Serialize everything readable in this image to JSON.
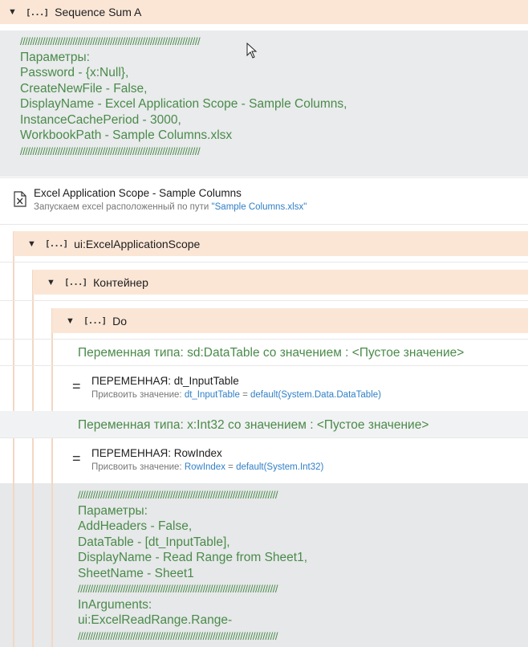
{
  "sequence": {
    "title": "Sequence Sum A"
  },
  "top_annotation": {
    "slashes": "////////////////////////////////////////////////////////////////////////",
    "lines": [
      "Параметры:",
      "Password - {x:Null},",
      "CreateNewFile - False,",
      "DisplayName - Excel Application Scope - Sample Columns,",
      "InstanceCachePeriod - 3000,",
      "WorkbookPath - Sample Columns.xlsx"
    ]
  },
  "excel_scope": {
    "title": "Excel Application Scope - Sample Columns",
    "subtitle_prefix": "Запускаем excel расположенный по пути ",
    "subtitle_path": "\"Sample Columns.xlsx\""
  },
  "scope_header": {
    "title": "ui:ExcelApplicationScope"
  },
  "container_header": {
    "title": "Контейнер"
  },
  "do_header": {
    "title": "Do"
  },
  "bracket_icon": "[...]",
  "variables": [
    {
      "declaration": "Переменная типа: sd:DataTable со значением : <Пустое значение>",
      "title_prefix": "ПЕРЕМЕННАЯ: ",
      "name": "dt_InputTable",
      "assign_prefix": "Присвоить значение: ",
      "assign_var": "dt_InputTable",
      "assign_eq": " = ",
      "assign_value": "default(System.Data.DataTable)"
    },
    {
      "declaration": "Переменная типа: x:Int32 со значением : <Пустое значение>",
      "title_prefix": "ПЕРЕМЕННАЯ: ",
      "name": "RowIndex",
      "assign_prefix": "Присвоить значение: ",
      "assign_var": "RowIndex",
      "assign_eq": " = ",
      "assign_value": "default(System.Int32)"
    }
  ],
  "bottom_annotation": {
    "slashes": "////////////////////////////////////////////////////////////////////////////////",
    "lines1": [
      "Параметры:",
      "AddHeaders - False,",
      "DataTable - [dt_InputTable],",
      "DisplayName - Read Range from Sheet1,",
      "SheetName - Sheet1"
    ],
    "lines2": [
      "InArguments:",
      "ui:ExcelReadRange.Range-"
    ]
  },
  "icons": {
    "expand": "triangle-down-icon",
    "excel_file": "excel-file-icon",
    "assign": "assign-equals-icon",
    "cursor": "mouse-cursor-icon"
  }
}
